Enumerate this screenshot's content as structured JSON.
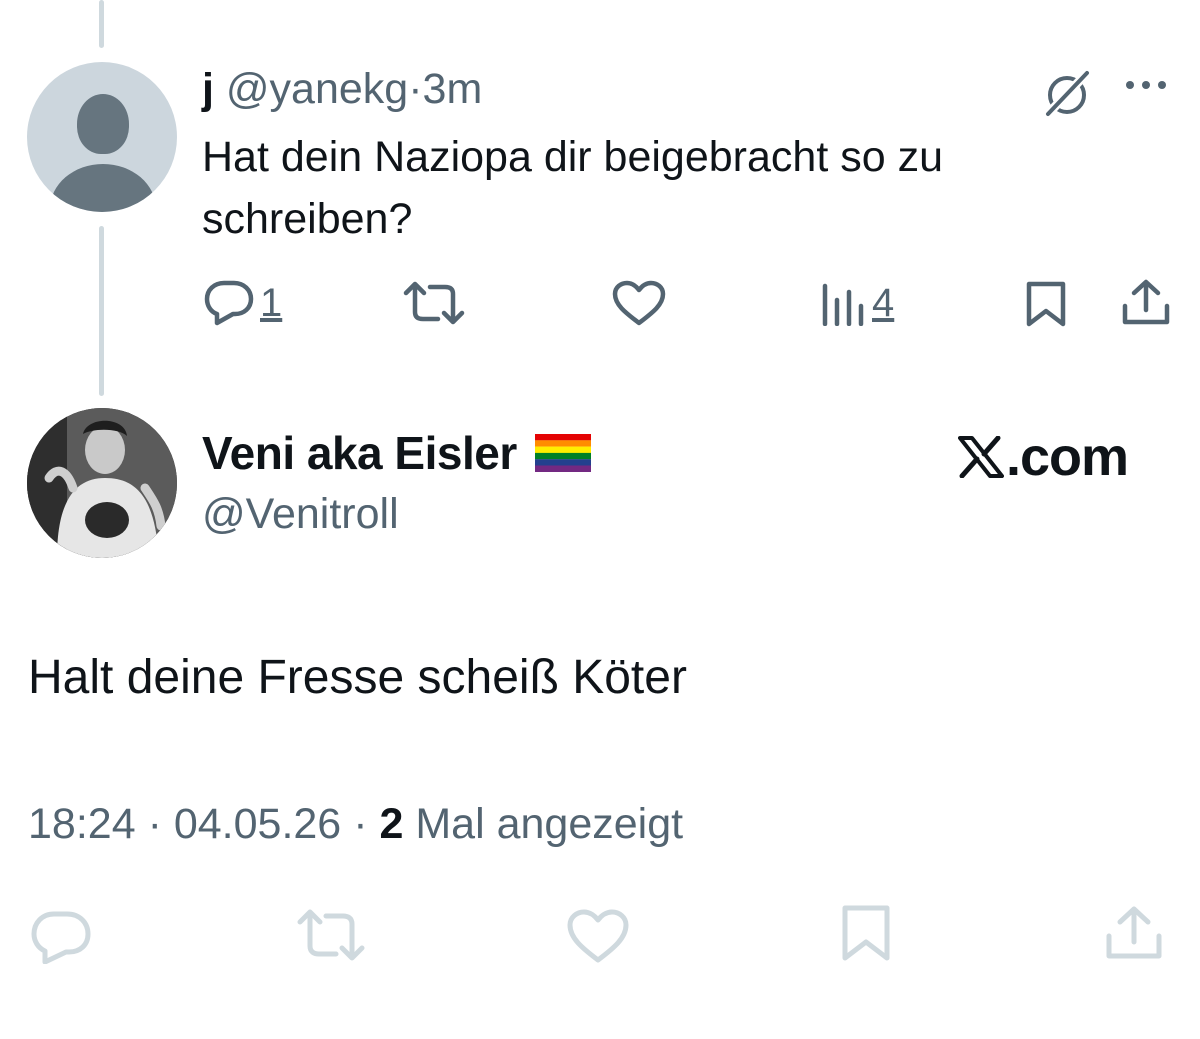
{
  "reply": {
    "name": "j",
    "handle": "@yanekg",
    "separator": "·",
    "time": "3m",
    "text": "Hat dein Naziopa dir beigebracht so zu schreiben?",
    "actions": {
      "reply_count": "1",
      "views_count": "4"
    },
    "icons": [
      "reply-icon",
      "retweet-icon",
      "like-icon",
      "views-icon",
      "bookmark-icon",
      "share-icon",
      "grok-icon",
      "more-icon"
    ]
  },
  "main": {
    "name": "Veni aka Eisler",
    "flag": "rainbow-flag",
    "handle": "@Venitroll",
    "brand": ".com",
    "text": "Halt deine Fresse scheiß Köter",
    "time": "18:24",
    "separator": "·",
    "date": "04.05.26",
    "views_number": "2",
    "views_label": "Mal angezeigt",
    "icons": [
      "reply-icon",
      "retweet-icon",
      "like-icon",
      "bookmark-icon",
      "share-icon"
    ]
  },
  "colors": {
    "text": "#0f1419",
    "secondary": "#536471",
    "thread_line": "#cfd9de",
    "avatar_bg": "#ccd6dd",
    "avatar_fg": "#66757f",
    "disabled_icon": "#cfd9de"
  }
}
